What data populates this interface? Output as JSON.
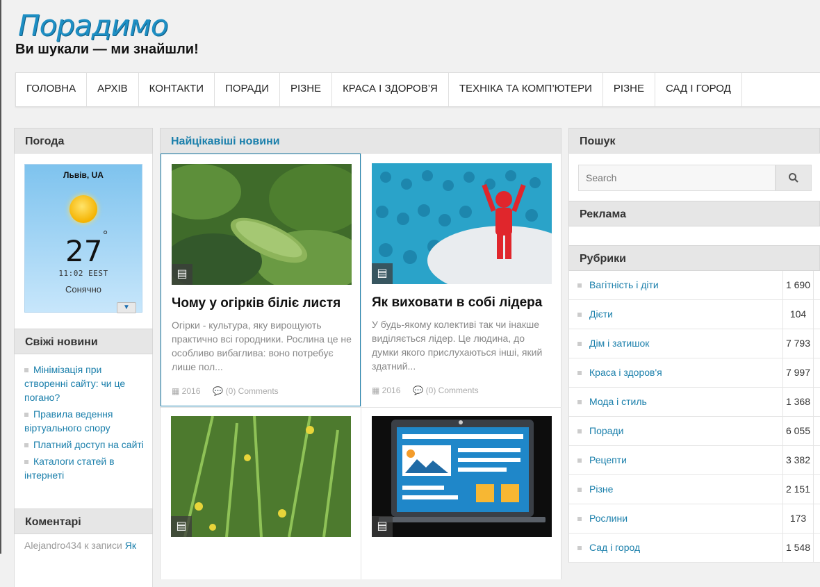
{
  "site": {
    "logo": "Порадимо",
    "tagline": "Ви шукали — ми знайшли!"
  },
  "nav": [
    "ГОЛОВНА",
    "АРХІВ",
    "КОНТАКТИ",
    "ПОРАДИ",
    "РІЗНЕ",
    "КРАСА І ЗДОРОВ’Я",
    "ТЕХНІКА ТА КОМП’ЮТЕРИ",
    "РІЗНЕ",
    "САД І ГОРОД"
  ],
  "left": {
    "weather_title": "Погода",
    "weather": {
      "city": "Львів, UA",
      "temp": "27",
      "deg": "°",
      "time": "11:02 EEST",
      "condition": "Сонячно"
    },
    "news_title": "Свіжі новини",
    "news": [
      "Мінімізація при створенні сайту: чи це погано?",
      "Правила ведення віртуального спору",
      "Платний доступ на сайті",
      "Каталоги статей в інтернеті"
    ],
    "comments_title": "Коментарі",
    "comment_author": "Alejandro434 к записи",
    "comment_link": "Як"
  },
  "middle": {
    "title": "Найцікавіші новини",
    "cards": [
      {
        "title": "Чому у огірків біліє листя",
        "excerpt": "Огірки - культура, яку вирощують практично всі городники. Рослина це не особливо вибаглива: воно потребує лише  пол...",
        "year": "2016",
        "comments": "(0) Comments"
      },
      {
        "title": "Як виховати в собі лідера",
        "excerpt": "У будь-якому колективі так чи інакше виділяється лідер. Це людина, до думки якого прислухаються інші, який здатний...",
        "year": "2016",
        "comments": "(0) Comments"
      }
    ]
  },
  "right": {
    "search_title": "Пошук",
    "search_placeholder": "Search",
    "ads_title": "Реклама",
    "rubrics_title": "Рубрики",
    "rubrics": [
      {
        "name": "Вагітність і діти",
        "count": "1 690"
      },
      {
        "name": "Дієти",
        "count": "104"
      },
      {
        "name": "Дім і затишок",
        "count": "7 793"
      },
      {
        "name": "Краса і здоров'я",
        "count": "7 997"
      },
      {
        "name": "Мода і стиль",
        "count": "1 368"
      },
      {
        "name": "Поради",
        "count": "6 055"
      },
      {
        "name": "Рецепти",
        "count": "3 382"
      },
      {
        "name": "Різне",
        "count": "2 151"
      },
      {
        "name": "Рослини",
        "count": "173"
      },
      {
        "name": "Сад і город",
        "count": "1 548"
      }
    ]
  }
}
